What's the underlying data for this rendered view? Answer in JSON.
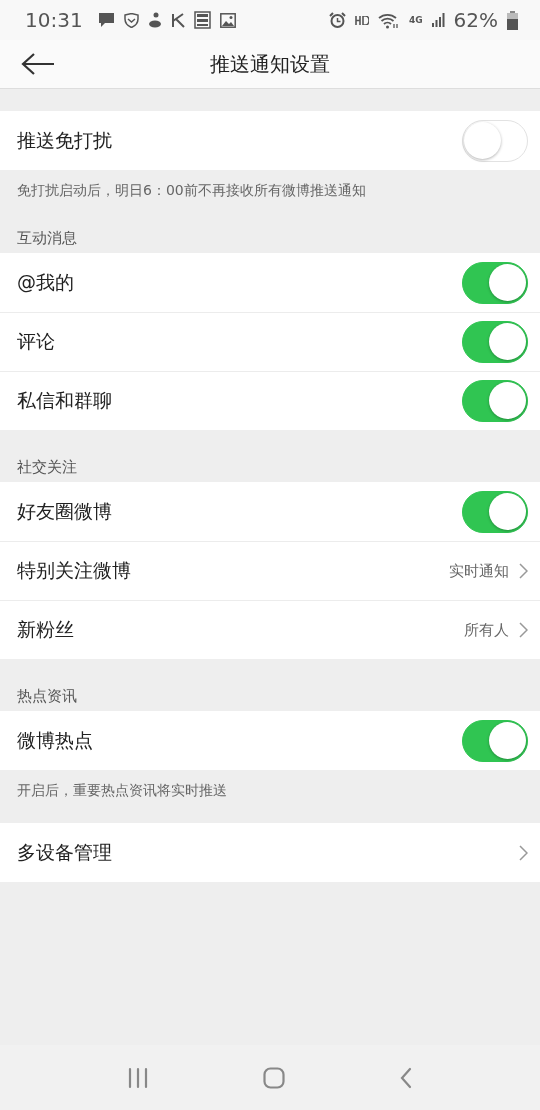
{
  "status_bar": {
    "time": "10:31",
    "network": "4G",
    "battery": "62%"
  },
  "header": {
    "title": "推送通知设置"
  },
  "sections": [
    {
      "items": [
        {
          "kind": "toggle",
          "label": "推送免打扰",
          "on": false
        }
      ],
      "note": "免打扰启动后，明日6：00前不再接收所有微博推送通知"
    },
    {
      "label": "互动消息",
      "items": [
        {
          "kind": "toggle",
          "label": "@我的",
          "on": true
        },
        {
          "kind": "toggle",
          "label": "评论",
          "on": true
        },
        {
          "kind": "toggle",
          "label": "私信和群聊",
          "on": true
        }
      ]
    },
    {
      "label": "社交关注",
      "items": [
        {
          "kind": "toggle",
          "label": "好友圈微博",
          "on": true
        },
        {
          "kind": "link",
          "label": "特别关注微博",
          "value": "实时通知"
        },
        {
          "kind": "link",
          "label": "新粉丝",
          "value": "所有人"
        }
      ]
    },
    {
      "label": "热点资讯",
      "items": [
        {
          "kind": "toggle",
          "label": "微博热点",
          "on": true
        }
      ],
      "note": "开启后，重要热点资讯将实时推送"
    },
    {
      "items": [
        {
          "kind": "link",
          "label": "多设备管理"
        }
      ]
    }
  ]
}
